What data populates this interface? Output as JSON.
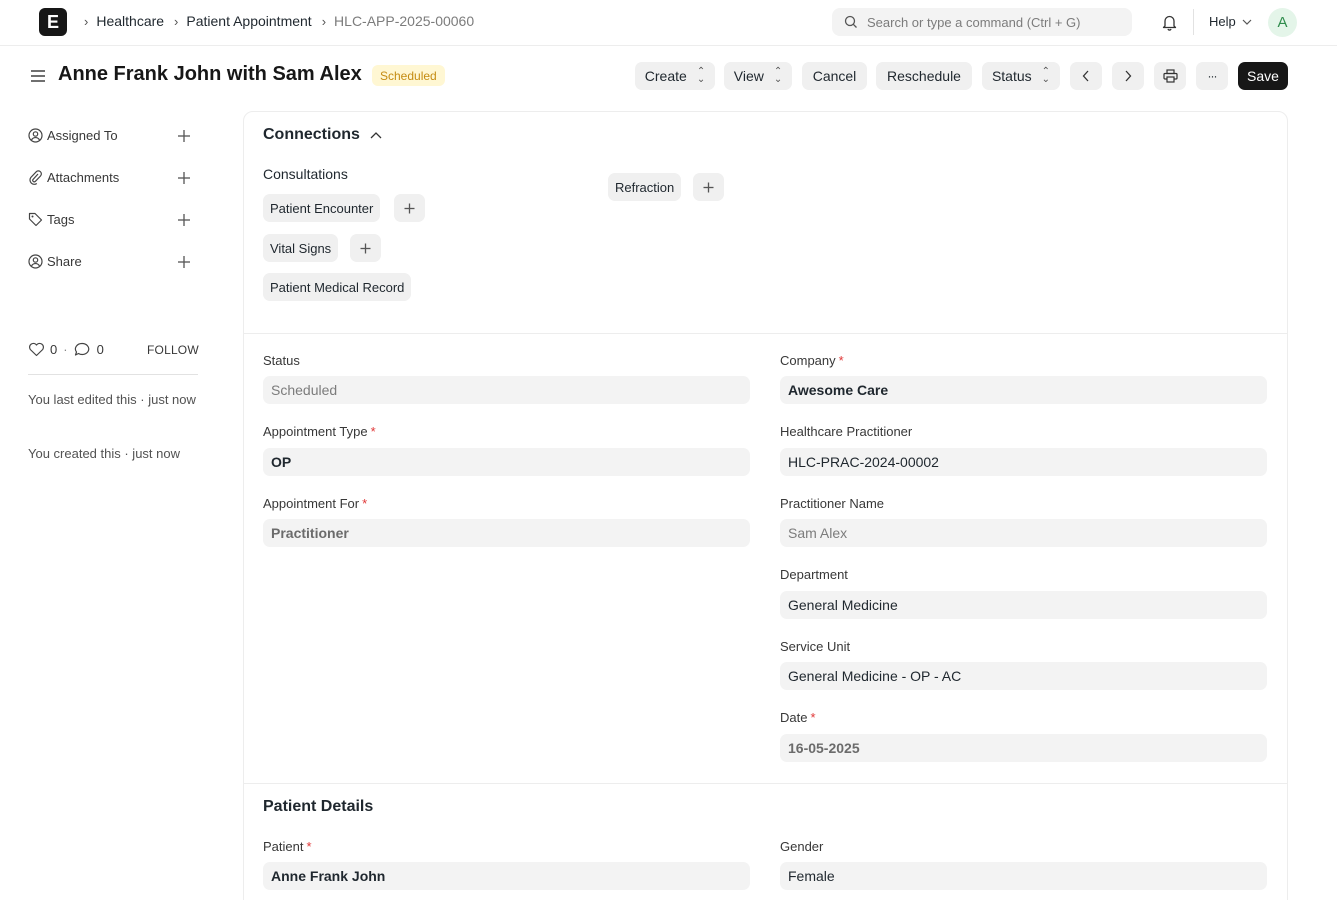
{
  "navbar": {
    "logo_letter": "E",
    "breadcrumbs": [
      "Healthcare",
      "Patient Appointment",
      "HLC-APP-2025-00060"
    ],
    "search_placeholder": "Search or type a command (Ctrl + G)",
    "help_label": "Help",
    "avatar_letter": "A"
  },
  "header": {
    "title": "Anne Frank John with Sam Alex",
    "status_badge": "Scheduled",
    "buttons": {
      "create": "Create",
      "view": "View",
      "cancel": "Cancel",
      "reschedule": "Reschedule",
      "status": "Status",
      "more": "···",
      "save": "Save"
    }
  },
  "sidebar": {
    "items": [
      {
        "label": "Assigned To",
        "icon": "user-add-icon"
      },
      {
        "label": "Attachments",
        "icon": "paperclip-icon"
      },
      {
        "label": "Tags",
        "icon": "tag-icon"
      },
      {
        "label": "Share",
        "icon": "share-user-icon"
      }
    ],
    "likes": "0",
    "comments": "0",
    "dot": "·",
    "follow_label": "FOLLOW",
    "last_edited": "You last edited this · just now",
    "created": "You created this · just now"
  },
  "connections": {
    "heading": "Connections",
    "group_label": "Consultations",
    "links": [
      "Patient Encounter",
      "Vital Signs",
      "Patient Medical Record",
      "Refraction"
    ]
  },
  "form": {
    "left": [
      {
        "label": "Status",
        "required": false,
        "value": "Scheduled"
      },
      {
        "label": "Appointment Type",
        "required": true,
        "value": "OP"
      },
      {
        "label": "Appointment For",
        "required": true,
        "value": "Practitioner"
      }
    ],
    "right": [
      {
        "label": "Company",
        "required": true,
        "value": "Awesome Care"
      },
      {
        "label": "Healthcare Practitioner",
        "required": false,
        "value": "HLC-PRAC-2024-00002"
      },
      {
        "label": "Practitioner Name",
        "required": false,
        "value": "Sam Alex"
      },
      {
        "label": "Department",
        "required": false,
        "value": "General Medicine"
      },
      {
        "label": "Service Unit",
        "required": false,
        "value": "General Medicine - OP - AC"
      },
      {
        "label": "Date",
        "required": true,
        "value": "16-05-2025"
      }
    ],
    "required_mark": "*"
  },
  "patient_details": {
    "heading": "Patient Details",
    "patient_label": "Patient",
    "patient_value": "Anne Frank John",
    "gender_label": "Gender",
    "gender_value": "Female"
  }
}
